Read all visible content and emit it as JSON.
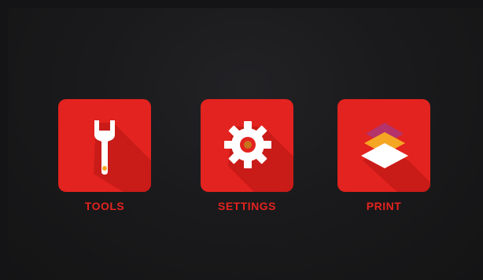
{
  "apps": [
    {
      "label": "TOOLS",
      "icon": "wrench-icon"
    },
    {
      "label": "SETTINGS",
      "icon": "gear-icon"
    },
    {
      "label": "PRINT",
      "icon": "layers-icon"
    }
  ],
  "colors": {
    "tile": "#e3231f",
    "shadow": "#c01917",
    "label": "#e3231f",
    "icon": "#ffffff",
    "gear_center": "#c8741e",
    "layer_top": "#b4336a",
    "layer_mid": "#f5a623",
    "layer_bottom": "#ffffff"
  }
}
